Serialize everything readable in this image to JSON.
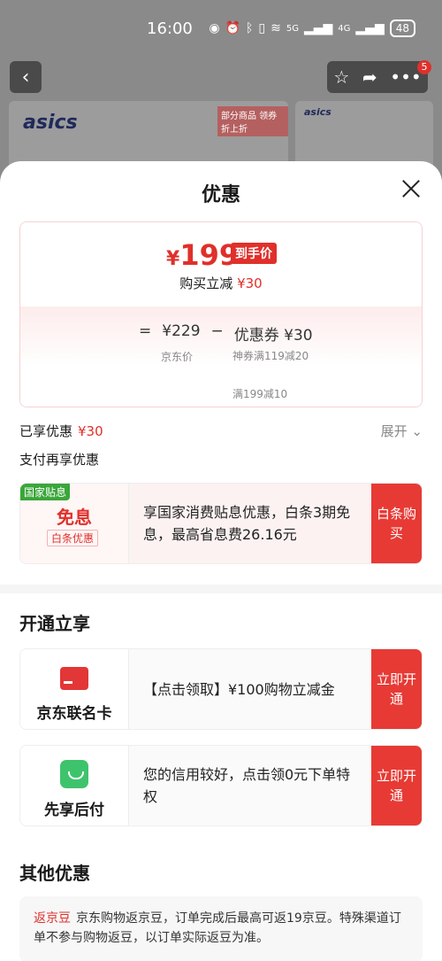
{
  "status_bar": {
    "time": "16:00",
    "battery": "48",
    "signal1": "5G",
    "signal2": "4G"
  },
  "background": {
    "brand": "asics",
    "brand_small": "asics",
    "tag": "部分商品 领券折上折",
    "notif_count": "5"
  },
  "sheet": {
    "title": "优惠"
  },
  "price": {
    "currency": "¥",
    "amount": "199",
    "badge": "到手价",
    "reduce_label": "购买立减",
    "reduce_amount": "¥30",
    "formula_eq": "=",
    "jd_price": "¥229",
    "formula_minus": "−",
    "coupon_total": "优惠券 ¥30",
    "jd_price_label": "京东价",
    "coupon_detail1": "神券满119减20",
    "coupon_detail2": "满199减10"
  },
  "enjoyed": {
    "label": "已享优惠",
    "amount": "¥30",
    "expand": "展开"
  },
  "pay_more": {
    "label": "支付再享优惠"
  },
  "free_interest": {
    "gov_tag": "国家贴息",
    "title": "免息",
    "sub": "白条优惠",
    "desc": "享国家消费贴息优惠，白条3期免息，最高省息费26.16元",
    "button": "白条购买"
  },
  "open_section": {
    "title": "开通立享",
    "jd_card": {
      "label": "京东联名卡",
      "desc": "【点击领取】¥100购物立减金",
      "button": "立即开通"
    },
    "pay_later": {
      "label": "先享后付",
      "desc": "您的信用较好，点击领0元下单特权",
      "button": "立即开通"
    }
  },
  "other_section": {
    "title": "其他优惠",
    "lead": "返京豆",
    "text": "京东购物返京豆，订单完成后最高可返19京豆。特殊渠道订单不参与购物返豆，以订单实际返豆为准。"
  },
  "colors": {
    "accent": "#e0302b",
    "gov_green": "#3aa63a",
    "pay_green": "#3ec36d"
  }
}
